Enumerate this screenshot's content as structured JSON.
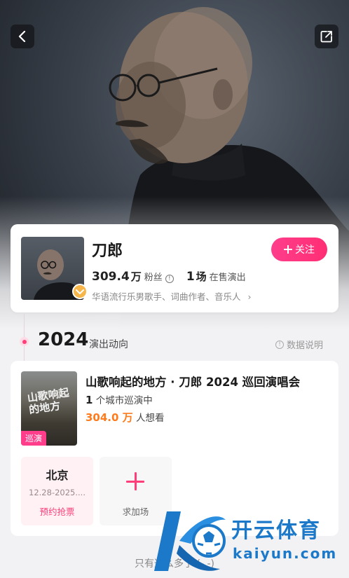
{
  "header": {
    "back_icon": "chevron-left-icon",
    "share_icon": "share-icon"
  },
  "artist": {
    "name": "刀郎",
    "follow_label": "关注",
    "fans_count": "309.4",
    "fans_unit": "万",
    "fans_label": "粉丝",
    "shows_count": "1",
    "shows_unit": "场",
    "shows_label": "在售演出",
    "tags": "华语流行乐男歌手、词曲作者、音乐人",
    "badge_icon": "heart-badge-icon"
  },
  "timeline": {
    "year": "2024",
    "section_title": "演出动向",
    "data_note": "数据说明"
  },
  "event": {
    "title": "山歌响起的地方 · 刀郎 2024 巡回演唱会",
    "poster_text": "山歌响起的地方",
    "tour_badge": "巡演",
    "city_count": "1",
    "city_suffix": "个城市巡演中",
    "want_count": "304.0 万",
    "want_suffix": "人想看",
    "city_tile": {
      "name": "北京",
      "date": "12.28-2025....",
      "status": "预约抢票"
    },
    "request_tile": {
      "label": "求加场"
    }
  },
  "footer": {
    "end_text": "只有这么多了 (-.-)"
  },
  "watermark": {
    "brand": "开云体育",
    "domain": "kaiyun.com"
  },
  "colors": {
    "accent": "#ff3d78",
    "orange": "#ff7a1a",
    "watermark_blue": "#1c79c9"
  }
}
